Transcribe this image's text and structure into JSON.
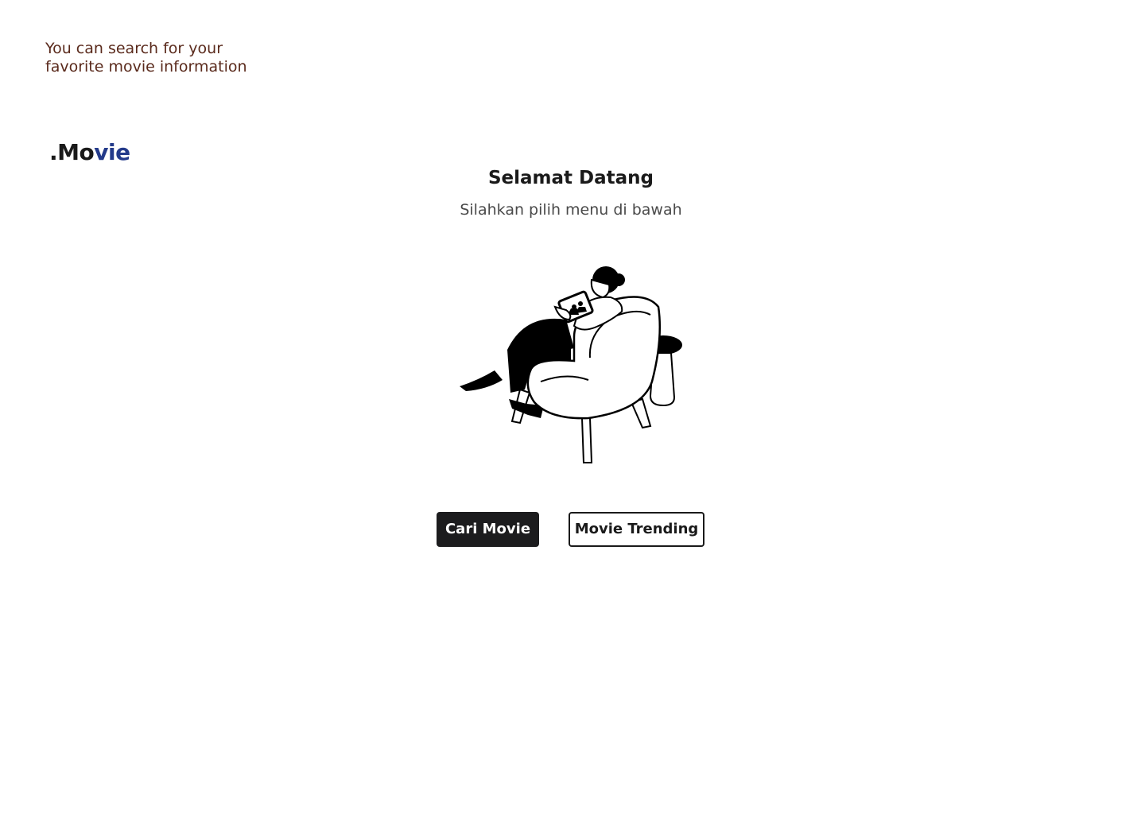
{
  "header": {
    "tagline_line1": "You can search for your",
    "tagline_line2": "favorite movie information"
  },
  "logo": {
    "dot": ".",
    "part1": "Mo",
    "part2": "vie"
  },
  "main": {
    "title": "Selamat Datang",
    "subtitle": "Silahkan pilih menu di bawah",
    "illustration_icon": "woman-reading-tablet-in-armchair-illustration"
  },
  "actions": {
    "search_label": "Cari Movie",
    "trending_label": "Movie Trending"
  },
  "colors": {
    "tagline": "#5a2a1c",
    "logo_accent": "#233a8a",
    "primary_button_bg": "#1c1c1e",
    "text": "#1a1a1a"
  }
}
